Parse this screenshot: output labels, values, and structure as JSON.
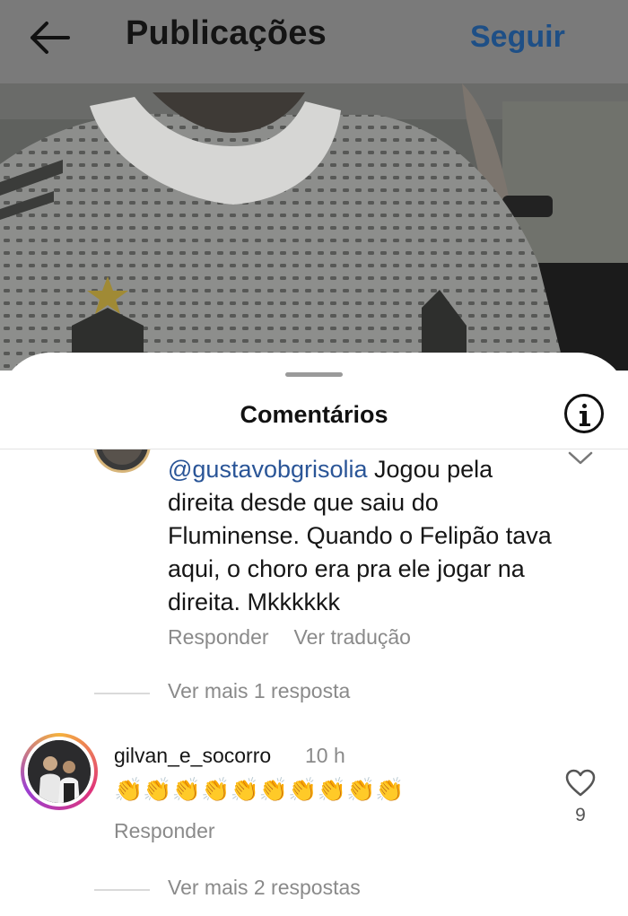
{
  "topbar": {
    "title": "Publicações",
    "follow_label": "Seguir"
  },
  "sheet": {
    "title": "Comentários"
  },
  "comments": [
    {
      "mention": "@gustavobgrisolia",
      "text": " Jogou pela direita desde que saiu do Fluminense.  Quando o Felipão tava aqui, o choro era pra ele jogar na direita. Mkkkkkk",
      "reply_label": "Responder",
      "translate_label": "Ver tradução",
      "more_replies": "Ver mais 1 resposta"
    },
    {
      "username": "gilvan_e_socorro",
      "time": "10 h",
      "text": "👏👏👏👏👏👏👏👏👏👏",
      "reply_label": "Responder",
      "likes": "9",
      "more_replies": "Ver mais 2 respostas"
    }
  ],
  "icons": {
    "back": "arrow-left-icon",
    "info": "info-icon",
    "collapse": "chevron-down-icon",
    "like": "heart-icon"
  },
  "colors": {
    "follow": "#1e4f86",
    "mention": "#2a5597",
    "muted": "#8a8a8a"
  }
}
